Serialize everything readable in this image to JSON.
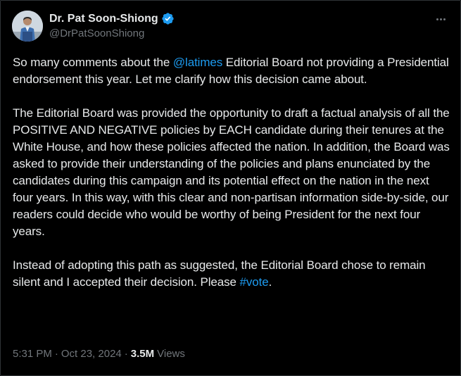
{
  "author": {
    "display_name": "Dr. Pat Soon-Shiong",
    "handle": "@DrPatSoonShiong",
    "avatar_icon": "profile-photo",
    "verified_icon": "verified-badge-icon",
    "verified_color": "#1d9bf0"
  },
  "tweet": {
    "p1_before": "So many comments about the ",
    "p1_mention": "@latimes",
    "p1_after": " Editorial Board not providing a Presidential endorsement this year. Let me clarify how this decision came about.",
    "p2": "The Editorial Board was provided the opportunity to draft a factual analysis of all the POSITIVE AND NEGATIVE policies by EACH candidate during their tenures at the White House, and how these policies affected the nation. In addition, the Board was asked to provide their understanding of the policies and plans enunciated by the candidates during this campaign and its potential effect on the nation in the next four years. In this way, with this clear and non-partisan information side-by-side, our readers could decide who would be worthy of being President for the next four years.",
    "p3_before": "Instead of adopting this path as suggested, the Editorial Board chose to remain silent and I accepted their decision. Please ",
    "p3_hashtag": "#vote",
    "p3_after": "."
  },
  "meta": {
    "time": "5:31 PM",
    "separator": "·",
    "date": "Oct 23, 2024",
    "views_count": "3.5M",
    "views_label": "Views"
  },
  "colors": {
    "background": "#000000",
    "text": "#e7e9ea",
    "secondary": "#71767b",
    "link": "#1d9bf0"
  },
  "more_icon": "more-horizontal-icon"
}
